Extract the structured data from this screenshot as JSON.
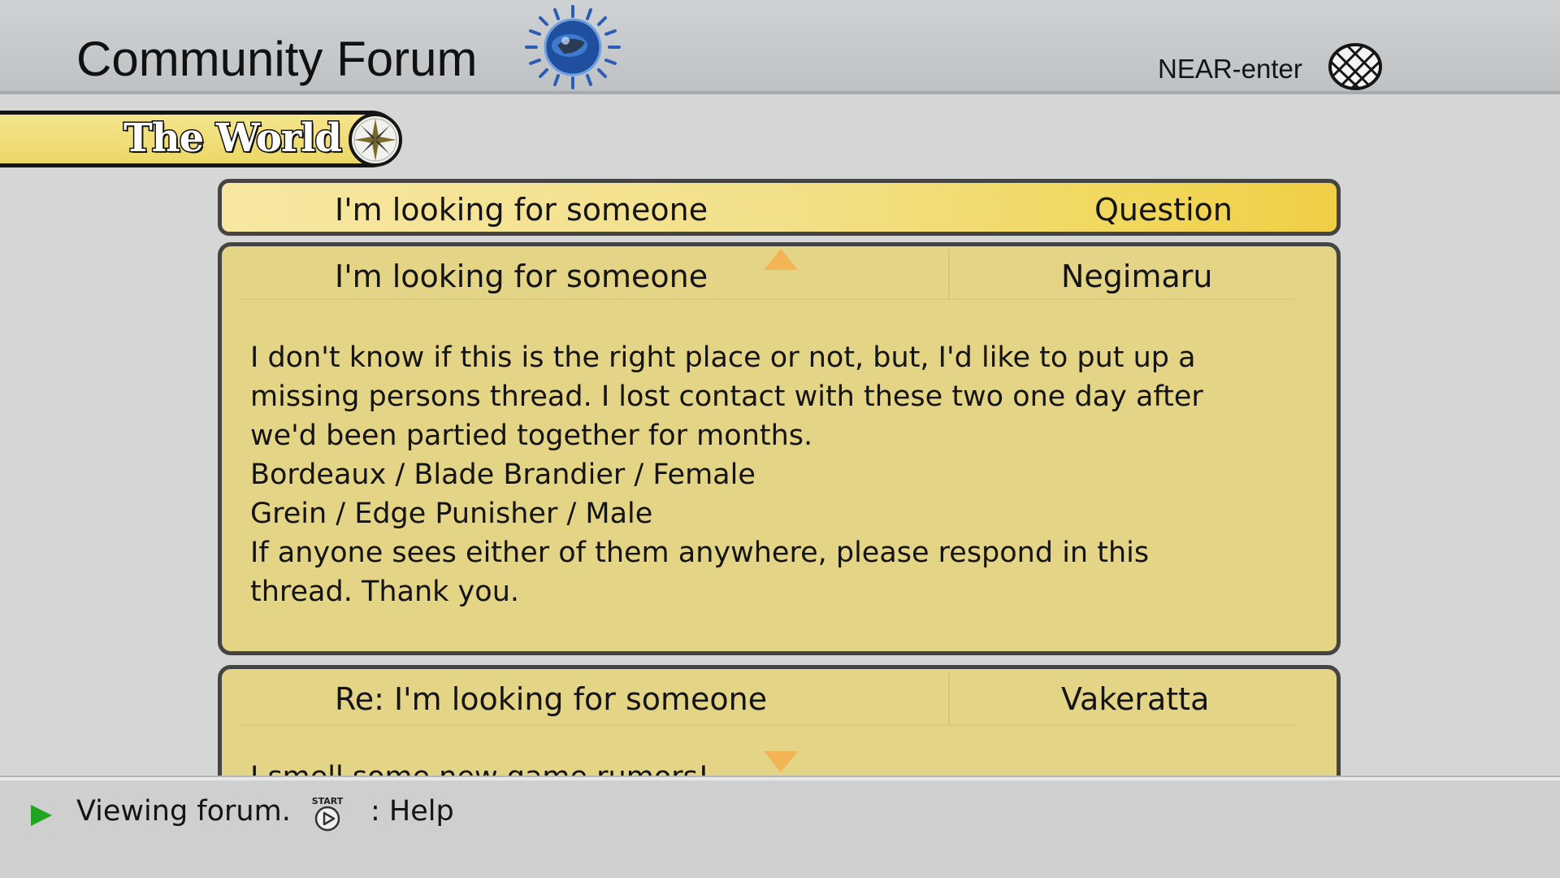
{
  "header": {
    "title": "Community Forum",
    "location": "NEAR-enter",
    "logo_icon": "globe-logo-icon",
    "network_icon": "network-globe-icon"
  },
  "world_tab": {
    "label": "The World",
    "icon": "compass-icon"
  },
  "thread": {
    "title": "I'm looking for someone",
    "tag": "Question"
  },
  "posts": [
    {
      "subject": "I'm looking for someone",
      "author": "Negimaru",
      "body": "I don't know if this is the right place or not, but, I'd like to put up a\nmissing persons thread. I lost contact with these two one day after\nwe'd been partied together for months.\nBordeaux / Blade Brandier / Female\nGrein / Edge Punisher / Male\nIf anyone sees either of them anywhere, please respond in this\nthread. Thank you."
    },
    {
      "subject": "Re: I'm looking for someone",
      "author": "Vakeratta",
      "body": "I smell some new game rumors!"
    }
  ],
  "footer": {
    "status": "Viewing forum.",
    "start_label": "START",
    "help": ": Help"
  },
  "colors": {
    "post_bg": "#e4d486",
    "accent_yellow": "#f0cf45",
    "scroll_arrow": "#f2b454",
    "play_arrow": "#22a422"
  }
}
